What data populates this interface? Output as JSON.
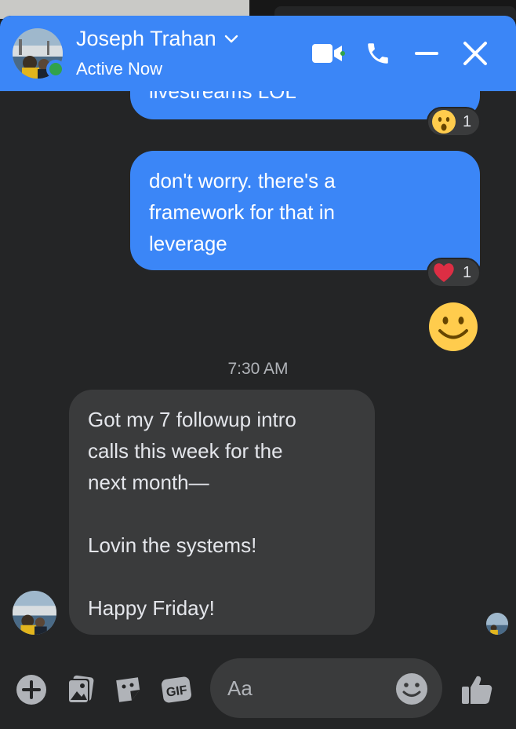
{
  "header": {
    "contact_name": "Joseph Trahan",
    "status": "Active Now",
    "accent_color": "#3b86f7"
  },
  "messages": {
    "outgoing_1_partial": "livestreams LOL",
    "outgoing_1_reaction_count": "1",
    "outgoing_2_lines": [
      "don't worry. there's a",
      "framework for that in",
      "leverage"
    ],
    "outgoing_2_reaction_count": "1",
    "timestamp": "7:30 AM",
    "incoming_lines": [
      "Got my 7 followup intro",
      "calls this week for the",
      "next month—",
      "",
      "Lovin the systems!",
      "",
      "Happy Friday!"
    ]
  },
  "composer": {
    "placeholder": "Aa",
    "gif_label": "GIF"
  },
  "icons": {
    "video": "video-camera-icon",
    "phone": "phone-icon",
    "minimize": "minimize-icon",
    "close": "close-icon",
    "add": "plus-circle-icon",
    "photo": "photo-icon",
    "sticker": "sticker-icon",
    "gif": "gif-icon",
    "emoji": "emoji-icon",
    "like": "thumbs-up-icon"
  }
}
